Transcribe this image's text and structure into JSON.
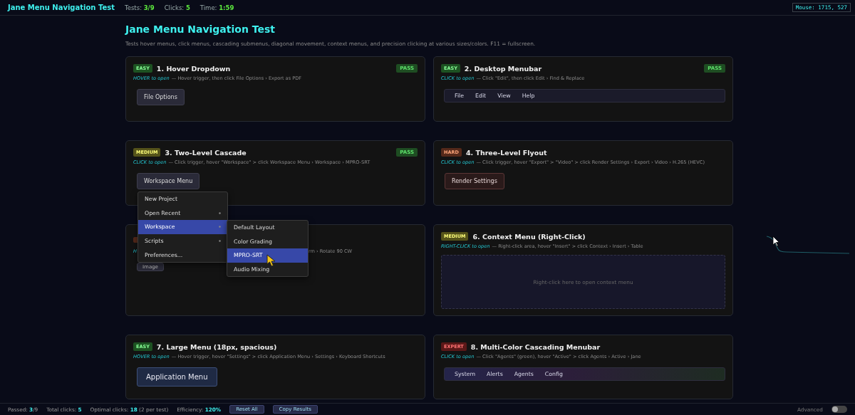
{
  "topbar": {
    "title": "Jane Menu Navigation Test",
    "stats": [
      {
        "label": "Tests:",
        "value": "3/9"
      },
      {
        "label": "Clicks:",
        "value": "5"
      },
      {
        "label": "Time:",
        "value": "1:59"
      }
    ],
    "mouse": "Mouse: 1715, 527"
  },
  "heading": "Jane Menu Navigation Test",
  "subtitle": "Tests hover menus, click menus, cascading submenus, diagonal movement, context menus, and precision clicking at various sizes/colors. F11 = fullscreen.",
  "cards": [
    {
      "kind": "button",
      "color": "#1d5222",
      "difficulty": "EASY",
      "title": "1. Hover Dropdown",
      "result": "PASS",
      "mode": "HOVER to open",
      "instruction": "— Hover trigger, then click File Options › Export as PDF",
      "button": "File Options"
    },
    {
      "kind": "menubar",
      "color": "#1d5222",
      "difficulty": "EASY",
      "title": "2. Desktop Menubar",
      "result": "PASS",
      "mode": "CLICK to open",
      "instruction": "— Click \"Edit\", then click Edit › Find & Replace",
      "items": [
        "File",
        "Edit",
        "View",
        "Help"
      ]
    },
    {
      "kind": "button",
      "color": "#55531a",
      "difficulty": "MEDIUM",
      "title": "3. Two-Level Cascade",
      "result": "PASS",
      "mode": "CLICK to open",
      "instruction": "— Click trigger, hover \"Workspace\" > click Workspace Menu › Workspace › MPRO-SRT",
      "button": "Workspace Menu",
      "open_menu": {
        "items": [
          {
            "label": "New Project",
            "submenu": false,
            "selected": false
          },
          {
            "label": "Open Recent",
            "submenu": true,
            "selected": false
          },
          {
            "label": "Workspace",
            "submenu": true,
            "selected": true
          },
          {
            "label": "Scripts",
            "submenu": true,
            "selected": false
          },
          {
            "label": "Preferences...",
            "submenu": false,
            "selected": false
          }
        ],
        "submenu": [
          {
            "label": "Default Layout",
            "selected": false
          },
          {
            "label": "Color Grading",
            "selected": false
          },
          {
            "label": "MPRO-SRT",
            "selected": true
          },
          {
            "label": "Audio Mixing",
            "selected": false
          }
        ]
      }
    },
    {
      "kind": "redbutton",
      "color": "#55291a",
      "difficulty": "HARD",
      "title": "4. Three-Level Flyout",
      "mode": "CLICK to open",
      "instruction": "— Click trigger, hover \"Export\" > \"Video\" > click Render Settings › Export › Video › H.265 (HEVC)",
      "button": "Render Settings"
    },
    {
      "kind": "covered",
      "color": "#55291a",
      "mode": "H",
      "instruction": "rm › Rotate 90 CW",
      "button": "Image"
    },
    {
      "kind": "area",
      "color": "#55531a",
      "difficulty": "MEDIUM",
      "title": "6. Context Menu (Right-Click)",
      "mode": "RIGHT-CLICK to open",
      "instruction": "— Right-click area, hover \"Insert\" > click Context › Insert › Table",
      "area": "Right-click here to open context menu"
    },
    {
      "kind": "largebutton",
      "color": "#1d5222",
      "difficulty": "EASY",
      "title": "7. Large Menu (18px, spacious)",
      "mode": "HOVER to open",
      "instruction": "— Hover trigger, hover \"Settings\" > click Application Menu › Settings › Keyboard Shortcuts",
      "button": "Application Menu"
    },
    {
      "kind": "colorbar",
      "color": "#5a1818",
      "difficulty": "EXPERT",
      "title": "8. Multi-Color Cascading Menubar",
      "mode": "CLICK to open",
      "instruction": "— Click \"Agents\" (green), hover \"Active\" > click Agents › Active › Jane",
      "items": [
        "System",
        "Alerts",
        "Agents",
        "Config"
      ]
    }
  ],
  "footer": {
    "stats": [
      {
        "label": "Passed:",
        "value": "3",
        "extra": "/9"
      },
      {
        "label": "Total clicks:",
        "value": "5"
      },
      {
        "label": "Optimal clicks:",
        "value": "18",
        "extra": " (2 per test)"
      },
      {
        "label": "Efficiency:",
        "value": "120%"
      }
    ],
    "buttons": [
      "Reset All",
      "Copy Results"
    ],
    "toggle": {
      "label": "Advanced",
      "on": false
    }
  }
}
